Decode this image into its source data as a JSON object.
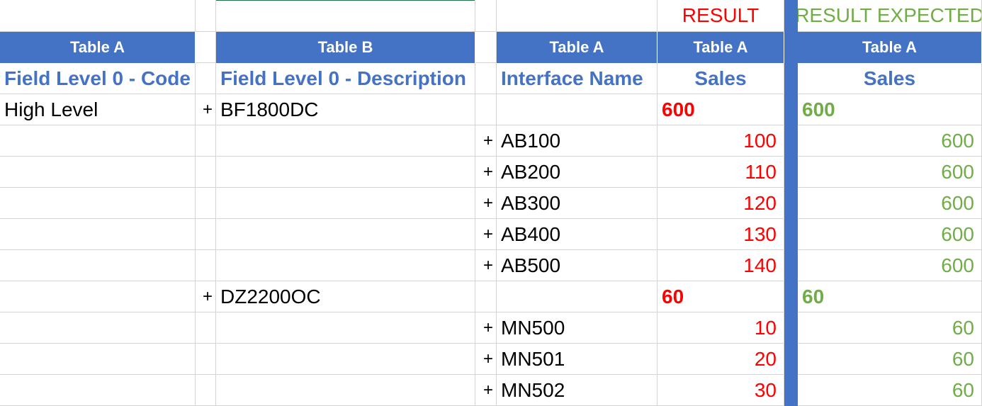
{
  "labels": {
    "result": "RESULT",
    "result_expected": "RESULT EXPECTED"
  },
  "headers": {
    "col_a": "Table A",
    "col_c": "Table B",
    "col_e": "Table A",
    "col_f": "Table A",
    "col_h": "Table A"
  },
  "subheaders": {
    "col_a": "Field Level 0 - Code",
    "col_c": "Field Level 0 - Description",
    "col_e": "Interface Name",
    "col_f": "Sales",
    "col_h": "Sales"
  },
  "rows": [
    {
      "code": "High Level",
      "plus_desc": "+",
      "desc": "BF1800DC",
      "plus_iface": "",
      "iface": "",
      "result": "600",
      "expected": "600",
      "bold": true
    },
    {
      "code": "",
      "plus_desc": "",
      "desc": "",
      "plus_iface": "+",
      "iface": "AB100",
      "result": "100",
      "expected": "600",
      "bold": false
    },
    {
      "code": "",
      "plus_desc": "",
      "desc": "",
      "plus_iface": "+",
      "iface": "AB200",
      "result": "110",
      "expected": "600",
      "bold": false
    },
    {
      "code": "",
      "plus_desc": "",
      "desc": "",
      "plus_iface": "+",
      "iface": "AB300",
      "result": "120",
      "expected": "600",
      "bold": false
    },
    {
      "code": "",
      "plus_desc": "",
      "desc": "",
      "plus_iface": "+",
      "iface": "AB400",
      "result": "130",
      "expected": "600",
      "bold": false
    },
    {
      "code": "",
      "plus_desc": "",
      "desc": "",
      "plus_iface": "+",
      "iface": "AB500",
      "result": "140",
      "expected": "600",
      "bold": false
    },
    {
      "code": "",
      "plus_desc": "+",
      "desc": "DZ2200OC",
      "plus_iface": "",
      "iface": "",
      "result": "60",
      "expected": "60",
      "bold": true
    },
    {
      "code": "",
      "plus_desc": "",
      "desc": "",
      "plus_iface": "+",
      "iface": "MN500",
      "result": "10",
      "expected": "60",
      "bold": false
    },
    {
      "code": "",
      "plus_desc": "",
      "desc": "",
      "plus_iface": "+",
      "iface": "MN501",
      "result": "20",
      "expected": "60",
      "bold": false
    },
    {
      "code": "",
      "plus_desc": "",
      "desc": "",
      "plus_iface": "+",
      "iface": "MN502",
      "result": "30",
      "expected": "60",
      "bold": false
    }
  ],
  "colors": {
    "header_bg": "#4472c4",
    "result": "#ff0000",
    "expected": "#70ad47"
  }
}
